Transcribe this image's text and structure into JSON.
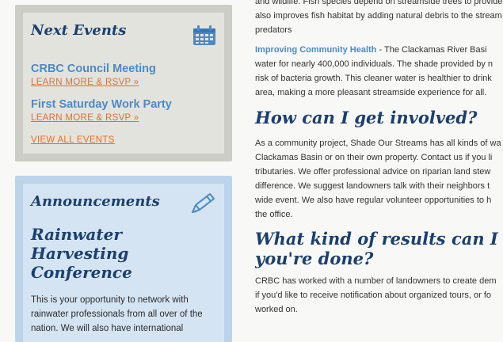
{
  "sidebar": {
    "events": {
      "title": "Next Events",
      "items": [
        {
          "title": "CRBC Council Meeting",
          "link": "LEARN MORE & RSVP »"
        },
        {
          "title": "First Saturday Work Party",
          "link": "LEARN MORE & RSVP »"
        }
      ],
      "view_all": "VIEW ALL EVENTS"
    },
    "announcements": {
      "title": "Announcements",
      "heading_lines": [
        "Rainwater",
        "Harvesting",
        "Conference"
      ],
      "body_lines": [
        "This is your opportunity to network with",
        "rainwater professionals from all over of the",
        "nation. We will also have international"
      ]
    }
  },
  "main": {
    "intro_lines": [
      "and wildlife. Fish species depend on streamside trees to provide",
      "also improves fish habitat by adding natural debris to the stream",
      "predators"
    ],
    "community": {
      "lead": "Improving Community Health",
      "first_rest": " - The Clackamas River Basi",
      "lines": [
        "water for nearly 400,000 individuals. The shade provided by n",
        "risk of bacteria growth. This cleaner water is healthier to drink",
        "area, making a more pleasant streamside experience for all."
      ]
    },
    "involved": {
      "heading": "How can I get involved?",
      "lines": [
        "As a community project, Shade Our Streams has all kinds of wa",
        "Clackamas Basin or on their own property. Contact us if you li",
        "tributaries.  We offer professional advice on riparian land stew",
        "difference. We suggest landowners talk with their neighbors t",
        "wide event. We also have regular volunteer opportunities to h",
        "the office."
      ]
    },
    "results": {
      "heading_lines": [
        "What kind of results can I lo",
        "you're done?"
      ],
      "lines": [
        "CRBC has worked with a number of landowners to create dem",
        "if you'd like to receive notification about organized tours, or fo",
        "worked on."
      ]
    }
  },
  "colors": {
    "heading_navy": "#1b3f6e",
    "link_blue": "#4b8ac6",
    "link_orange": "#e0702a",
    "events_bg": "#e3e3de",
    "announcements_bg": "#d5e4f3"
  },
  "icons": {
    "events": "calendar-icon",
    "announcements": "pencil-icon"
  }
}
